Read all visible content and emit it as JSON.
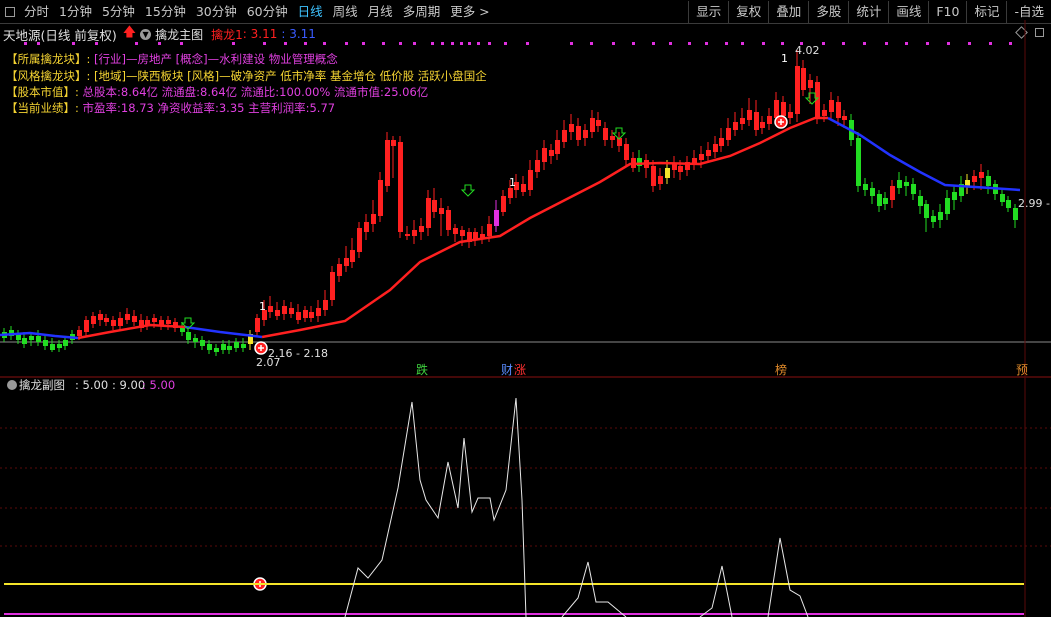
{
  "toolbar": {
    "periods": [
      "分时",
      "1分钟",
      "5分钟",
      "15分钟",
      "30分钟",
      "60分钟",
      "日线",
      "周线",
      "月线",
      "多周期",
      "更多 >"
    ],
    "active_period": "日线",
    "right_items": [
      "显示",
      "复权",
      "叠加",
      "多股",
      "统计",
      "画线",
      "F10",
      "标记",
      "-自选"
    ]
  },
  "stock": {
    "name": "天地源",
    "mode": "(日线 前复权)",
    "indicator_name": "擒龙主图",
    "param_label": "擒龙1",
    "param_value1": ": 3.11",
    "param_value2": ": 3.11"
  },
  "info_lines": [
    {
      "label": "【所属擒龙块】:",
      "value": "[行业]—房地产 [概念]—水利建设 物业管理概念",
      "value_color": "#e040e0"
    },
    {
      "label": "【风格擒龙块】:",
      "value": "[地域]—陕西板块 [风格]—破净资产 低市净率 基金增仓 低价股 活跃小盘国企",
      "value_color": "#f5d432"
    },
    {
      "label": "【股本市值】:",
      "value": "总股本:8.64亿 流通盘:8.64亿 流通比:100.00% 流通市值:25.06亿",
      "value_color": "#e040e0"
    },
    {
      "label": "【当前业绩】:",
      "value": "市盈率:18.73 净资收益率:3.35 主营利润率:5.77",
      "value_color": "#e040e0"
    }
  ],
  "price_labels": {
    "high": "4.02",
    "low_left": "2.07",
    "low_mid": "2.16 - 2.18",
    "last_price": "2.99 -",
    "signal_one": "1"
  },
  "event_markers": [
    {
      "text": "跌",
      "color": "#3ed23e"
    },
    {
      "text": "财",
      "color": "#5a8cff"
    },
    {
      "text": "涨",
      "color": "#ff3030"
    },
    {
      "text": "榜",
      "color": "#e08a2a"
    },
    {
      "text": "预",
      "color": "#e08a2a"
    }
  ],
  "sub_chart": {
    "name": "擒龙副图",
    "values": [
      ": 5.00",
      ": 9.00",
      ": 5.00"
    ]
  },
  "colors": {
    "up": "#ff2020",
    "down": "#22dd22",
    "ma_up": "#ff2020",
    "ma_down": "#2233ff",
    "yellow": "#f5e52a",
    "magenta": "#e030e0",
    "osc": "#e8e8e8"
  }
}
